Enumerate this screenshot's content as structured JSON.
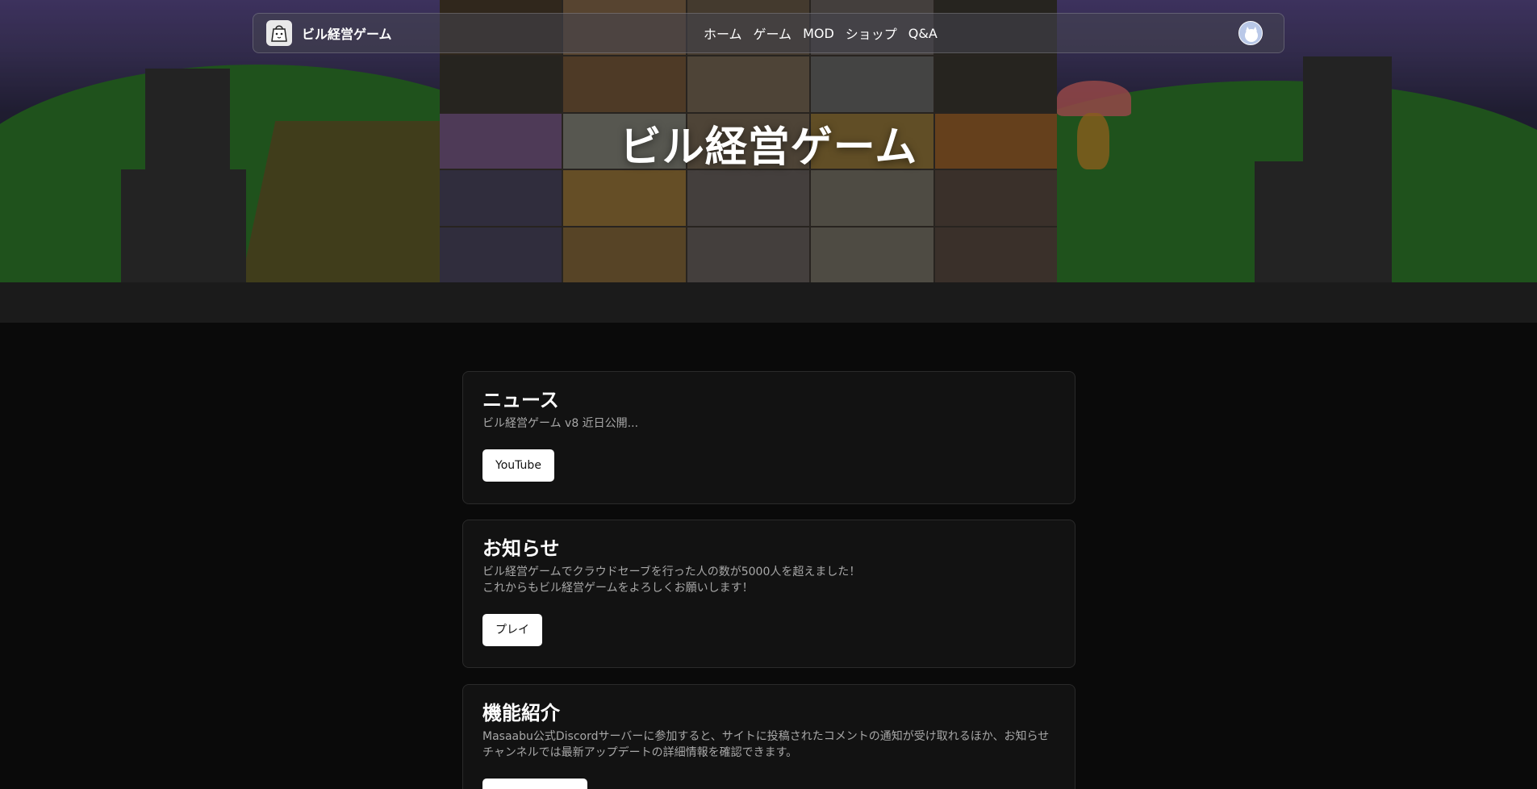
{
  "brand": {
    "name": "ビル経営ゲーム",
    "logo_icon": "bag-icon"
  },
  "nav": {
    "links": [
      "ホーム",
      "ゲーム",
      "MOD",
      "ショップ",
      "Q&A"
    ]
  },
  "hero": {
    "title": "ビル経営ゲーム"
  },
  "cards": {
    "news": {
      "title": "ニュース",
      "text": "ビル経営ゲーム v8 近日公開...",
      "button": "YouTube"
    },
    "notice": {
      "title": "お知らせ",
      "line1": "ビル経営ゲームでクラウドセーブを行った人の数が5000人を超えました！",
      "line2": "これからもビル経営ゲームをよろしくお願いします！",
      "button": "プレイ"
    },
    "features": {
      "title": "機能紹介",
      "line1": "Masaabu公式Discordサーバーに参加すると、サイトに投稿されたコメントの通知が受け取れるほか、お知らせ",
      "line2": "チャンネルでは最新アップデートの詳細情報を確認できます。"
    }
  },
  "colors": {
    "background": "#0a0a0a",
    "card": "#121212",
    "button": "#ffffff"
  }
}
